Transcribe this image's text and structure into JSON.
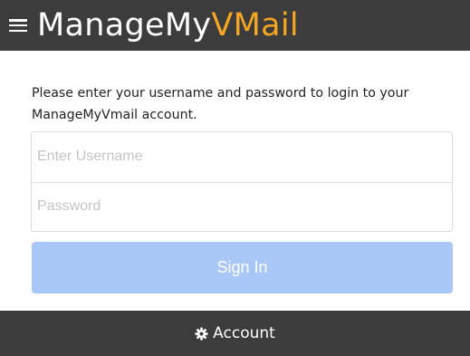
{
  "header": {
    "brand_main": "ManageMy",
    "brand_accent": "VMail",
    "menu_icon": "hamburger-menu-icon",
    "accent_color": "#f5a623",
    "bar_color": "#3c3c3c"
  },
  "login": {
    "intro_text": "Please enter your username and password to login to your ManageMyVmail account.",
    "username": {
      "value": "",
      "placeholder": "Enter Username"
    },
    "password": {
      "value": "",
      "placeholder": "Password"
    },
    "signin_label": "Sign In",
    "signin_color": "#a8c7f7"
  },
  "footer": {
    "account_label": "Account",
    "account_icon": "gear-icon"
  }
}
